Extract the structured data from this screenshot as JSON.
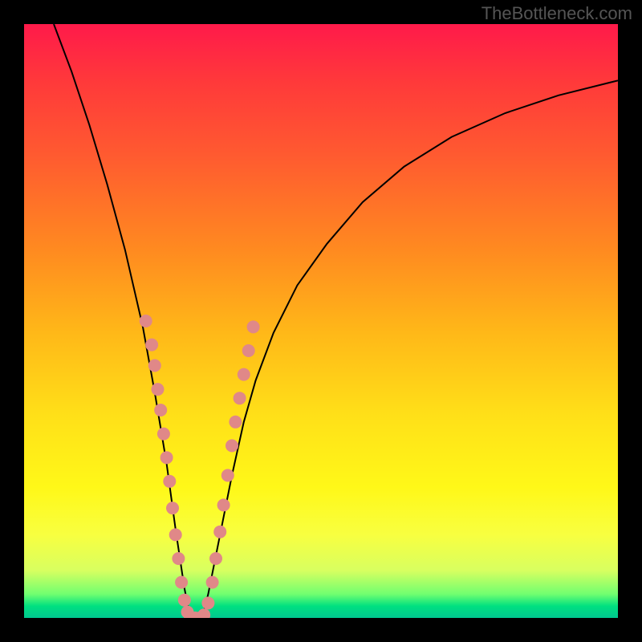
{
  "watermark": "TheBottleneck.com",
  "chart_data": {
    "type": "line",
    "title": "",
    "xlabel": "",
    "ylabel": "",
    "xlim": [
      0,
      100
    ],
    "ylim": [
      0,
      100
    ],
    "curve": {
      "description": "V-shaped bottleneck curve with minimum near x≈28",
      "points": [
        [
          5,
          100
        ],
        [
          8,
          92
        ],
        [
          11,
          83
        ],
        [
          14,
          73
        ],
        [
          17,
          62
        ],
        [
          20,
          49
        ],
        [
          22,
          38
        ],
        [
          24,
          26
        ],
        [
          25.5,
          15
        ],
        [
          27,
          5
        ],
        [
          28,
          0
        ],
        [
          30,
          0
        ],
        [
          31,
          4
        ],
        [
          33,
          14
        ],
        [
          35,
          24
        ],
        [
          37,
          33
        ],
        [
          39,
          40
        ],
        [
          42,
          48
        ],
        [
          46,
          56
        ],
        [
          51,
          63
        ],
        [
          57,
          70
        ],
        [
          64,
          76
        ],
        [
          72,
          81
        ],
        [
          81,
          85
        ],
        [
          90,
          88
        ],
        [
          100,
          90.5
        ]
      ]
    },
    "scatter_points": [
      [
        20.5,
        50
      ],
      [
        21.5,
        46
      ],
      [
        22,
        42.5
      ],
      [
        22.5,
        38.5
      ],
      [
        23,
        35
      ],
      [
        23.5,
        31
      ],
      [
        24,
        27
      ],
      [
        24.5,
        23
      ],
      [
        25,
        18.5
      ],
      [
        25.5,
        14
      ],
      [
        26,
        10
      ],
      [
        26.5,
        6
      ],
      [
        27,
        3
      ],
      [
        27.5,
        1
      ],
      [
        28,
        0
      ],
      [
        28.8,
        0
      ],
      [
        29.6,
        0
      ],
      [
        30.3,
        0.5
      ],
      [
        31,
        2.5
      ],
      [
        31.7,
        6
      ],
      [
        32.3,
        10
      ],
      [
        33,
        14.5
      ],
      [
        33.6,
        19
      ],
      [
        34.3,
        24
      ],
      [
        35,
        29
      ],
      [
        35.6,
        33
      ],
      [
        36.3,
        37
      ],
      [
        37,
        41
      ],
      [
        37.8,
        45
      ],
      [
        38.6,
        49
      ]
    ],
    "background": {
      "type": "vertical-gradient",
      "stops": [
        {
          "pos": 0,
          "color": "#ff1a4a"
        },
        {
          "pos": 50,
          "color": "#ffc818"
        },
        {
          "pos": 85,
          "color": "#f8ff40"
        },
        {
          "pos": 100,
          "color": "#00c890"
        }
      ]
    }
  }
}
